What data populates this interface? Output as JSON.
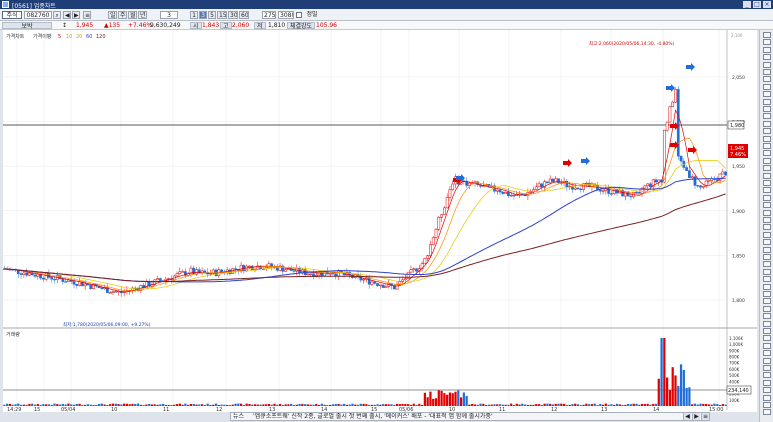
{
  "window": {
    "title": "[0561] 업종차트"
  },
  "toolbar": {
    "market": "주식",
    "code": "082760",
    "periods": [
      "일",
      "주",
      "월",
      "년"
    ],
    "tick_value": "3",
    "minutes": [
      "1",
      "3",
      "5",
      "15",
      "30",
      "60"
    ],
    "count": "275",
    "total": "3080",
    "checkbox_label": "정밀"
  },
  "quote": {
    "name": "보박",
    "price": "1,945",
    "change": "▲135",
    "rate": "+7.46%",
    "volume": "9,630,249",
    "open_label": "시",
    "open": "1,843",
    "high_label": "고",
    "high": "2,060",
    "low_label": "저",
    "low": "1,810",
    "strength_label": "체결강도",
    "strength": "105.96"
  },
  "legend": {
    "price_label": "가격차트",
    "ma_label": "가격이평",
    "ma": [
      {
        "label": "5",
        "color": "#e00000"
      },
      {
        "label": "10",
        "color": "#ff8c00"
      },
      {
        "label": "20",
        "color": "#e6c800"
      },
      {
        "label": "60",
        "color": "#3040d0"
      },
      {
        "label": "120",
        "color": "#7a2020"
      }
    ],
    "volume_label": "거래량"
  },
  "annotations": {
    "high": "최고:2,060(2020/05/06,14:30, -4.80%)",
    "low": "최저:1,780(2020/05/06,09:00, +9.27%)"
  },
  "price_axis": {
    "ticks": [
      "2,050",
      "2,000",
      "1,950",
      "1,900",
      "1,850",
      "1,800"
    ],
    "top_label": "2,100",
    "current_box": "1,945",
    "ref_box": "1,980",
    "pct_box": "7.46%"
  },
  "volume_axis": {
    "ticks": [
      "1,100K",
      "1,000K",
      "900K",
      "800K",
      "700K",
      "600K",
      "500K",
      "400K",
      "300K",
      "200K",
      "100K"
    ],
    "current_box": "234,140"
  },
  "x_axis": {
    "labels": [
      "14:29",
      "15",
      "05/04",
      "10",
      "11",
      "12",
      "13",
      "14",
      "15",
      "05/06",
      "10",
      "11",
      "12",
      "13",
      "14",
      "15:00"
    ]
  },
  "news": {
    "tag": "뉴스",
    "text": "'앱큐소프트웨' 신작 2종, 글로벌 출시 첫 번째 출시, '메이커스' 배포 - '대표적 앱 함께 출시가중'"
  },
  "colors": {
    "up": "#e00000",
    "down": "#1e6fd9",
    "ma5": "#e00000",
    "ma10": "#ff8c00",
    "ma20": "#e6c800",
    "ma60": "#3040d0",
    "ma120": "#7a2020"
  },
  "icons": [
    "app-icon",
    "minimize-icon",
    "maximize-icon",
    "close-icon",
    "cursor-icon",
    "trendline-icon",
    "arrow-up-icon",
    "arrow-down-icon",
    "zoom-icon"
  ]
}
